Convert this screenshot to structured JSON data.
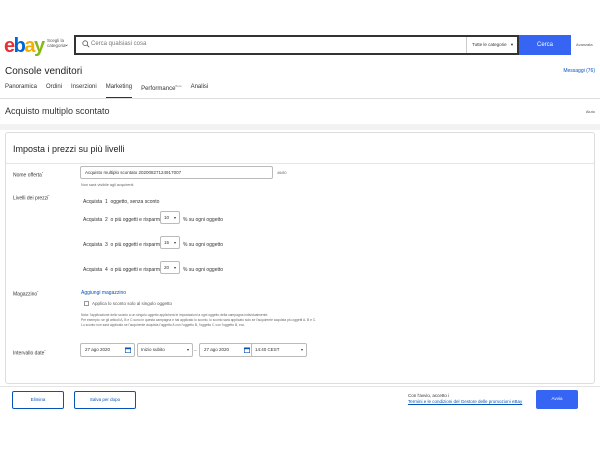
{
  "header": {
    "logo": {
      "e": "e",
      "b": "b",
      "a": "a",
      "y": "y"
    },
    "shop_by": "Scegli la categoria",
    "search_placeholder": "Cerca qualsiasi cosa",
    "category_select": "Tutte le categorie",
    "search_button": "Cerca",
    "advanced": "Avanzata"
  },
  "page": {
    "title": "Console venditori",
    "messages": "Messaggi (76)",
    "nav": [
      "Panoramica",
      "Ordini",
      "Inserzioni",
      "Marketing",
      "Performance",
      "Analisi"
    ],
    "nav_beta": "Beta",
    "active_nav": "Marketing",
    "subtitle": "Acquisto multiplo scontato",
    "help": "Aiuto"
  },
  "form": {
    "panel_title": "Imposta i prezzi su più livelli",
    "offer_name_label": "Nome offerta",
    "offer_name_value": "Acquisto multiplo scontato 20200827124917007",
    "offer_name_counter": "46/80",
    "offer_name_note": "Non sarà visibile agli acquirenti",
    "price_levels_label": "Livelli dei prezzi",
    "level1": {
      "a": "Acquista",
      "n": "1",
      "rest": "oggetto, senza sconto"
    },
    "levels": [
      {
        "acquista": "Acquista",
        "n": "2",
        "mid": "o più oggetti e risparmia",
        "pct": "10",
        "suffix": "% su ogni oggetto"
      },
      {
        "acquista": "Acquista",
        "n": "3",
        "mid": "o più oggetti e risparmia",
        "pct": "15",
        "suffix": "% su ogni oggetto"
      },
      {
        "acquista": "Acquista",
        "n": "4",
        "mid": "o più oggetti e risparmia",
        "pct": "20",
        "suffix": "% su ogni oggetto"
      }
    ],
    "warehouse_label": "Magazzino",
    "add_warehouse": "Aggiungi magazzino",
    "apply_single": "Applica lo sconto solo al singolo oggetto",
    "note1": "Nota: l'applicazione dello sconto a un singolo oggetto applicherà le impostazioni a ogni oggetto della campagna individualmente.",
    "note2": "Per esempio: se gli articoli A, B e C sono in questa campagna e hai applicato lo sconto, lo sconto sarà applicato solo se l'acquirente acquista più oggetti A, B e C.",
    "note3": "Lo sconto non sarà applicato se l'acquirente acquista l'oggetto A con l'oggetto B, l'oggetto C con l'oggetto B, ecc.",
    "date_label": "Intervallo date",
    "start_date": "27 ago 2020",
    "start_time": "Inizio subito",
    "dash": "–",
    "end_date": "27 ago 2020",
    "end_time": "14:40 CEST"
  },
  "footer": {
    "delete": "Elimina",
    "save_draft": "Salva per dopo",
    "terms_line1": "Con l'avvio, accetto i",
    "terms_line2": "Termini e le condizioni del Gestore delle promozioni eBay",
    "launch": "Avvia"
  },
  "colors": {
    "accent": "#3665f3",
    "link": "#0654ba"
  }
}
